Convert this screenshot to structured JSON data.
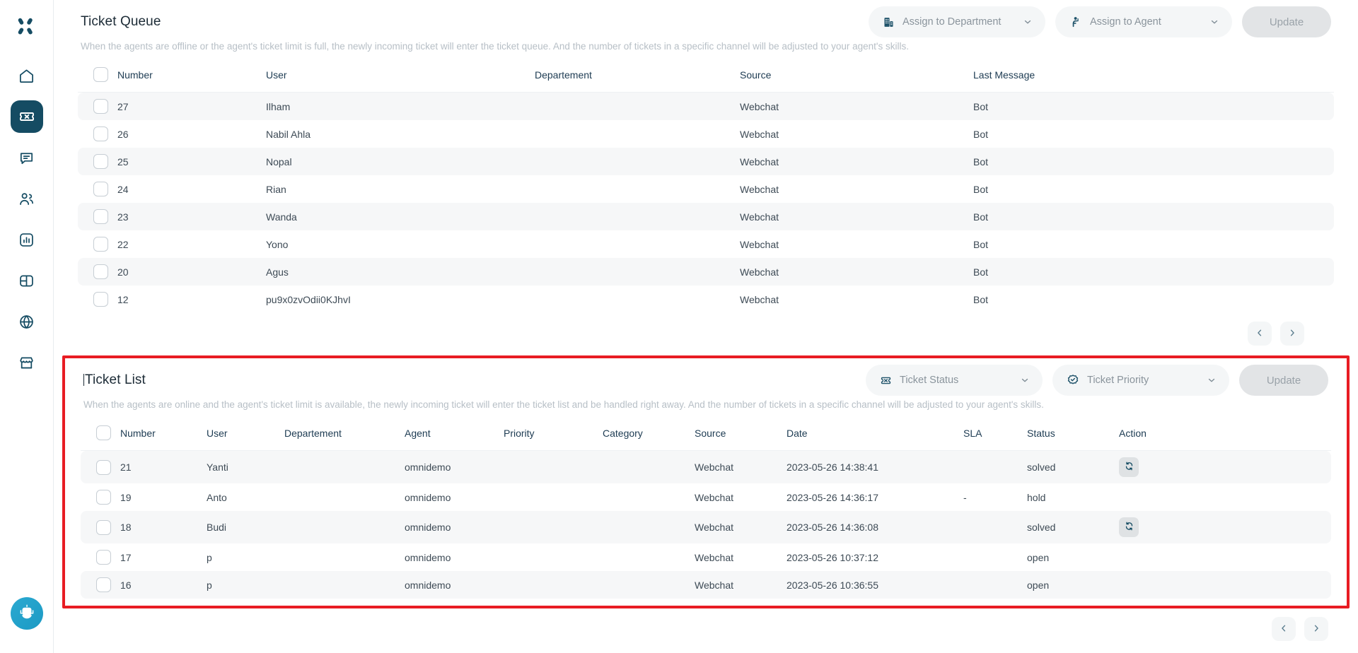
{
  "sidebar": {
    "logo_name": "app-logo",
    "items": [
      {
        "name": "home",
        "icon": "home-icon",
        "active": false
      },
      {
        "name": "ticket",
        "icon": "ticket-icon",
        "active": true
      },
      {
        "name": "chat",
        "icon": "chat-icon",
        "active": false
      },
      {
        "name": "contacts",
        "icon": "users-icon",
        "active": false
      },
      {
        "name": "analytics",
        "icon": "bar-chart-icon",
        "active": false
      },
      {
        "name": "products",
        "icon": "box-icon",
        "active": false
      },
      {
        "name": "channels",
        "icon": "globe-icon",
        "active": false
      },
      {
        "name": "store",
        "icon": "storefront-icon",
        "active": false
      }
    ],
    "bot_button": "chatbot-icon"
  },
  "queue": {
    "title": "Ticket Queue",
    "description": "When the agents are offline or the agent's ticket limit is full, the newly incoming ticket will enter the ticket queue. And the number of tickets in a specific channel will be adjusted to your agent's skills.",
    "assign_department": {
      "label": "Assign to Department",
      "icon": "building-icon"
    },
    "assign_agent": {
      "label": "Assign to Agent",
      "icon": "agent-icon"
    },
    "update_label": "Update",
    "columns": [
      "Number",
      "User",
      "Departement",
      "Source",
      "Last Message"
    ],
    "rows": [
      {
        "number": "27",
        "user": "Ilham",
        "departement": "",
        "source": "Webchat",
        "last_message": "Bot"
      },
      {
        "number": "26",
        "user": "Nabil Ahla",
        "departement": "",
        "source": "Webchat",
        "last_message": "Bot"
      },
      {
        "number": "25",
        "user": "Nopal",
        "departement": "",
        "source": "Webchat",
        "last_message": "Bot"
      },
      {
        "number": "24",
        "user": "Rian",
        "departement": "",
        "source": "Webchat",
        "last_message": "Bot"
      },
      {
        "number": "23",
        "user": "Wanda",
        "departement": "",
        "source": "Webchat",
        "last_message": "Bot"
      },
      {
        "number": "22",
        "user": "Yono",
        "departement": "",
        "source": "Webchat",
        "last_message": "Bot"
      },
      {
        "number": "20",
        "user": "Agus",
        "departement": "",
        "source": "Webchat",
        "last_message": "Bot"
      },
      {
        "number": "12",
        "user": "pu9x0zvOdii0KJhvI",
        "departement": "",
        "source": "Webchat",
        "last_message": "Bot"
      }
    ],
    "pager": {
      "prev": "chevron-left-icon",
      "next": "chevron-right-icon"
    }
  },
  "list": {
    "title": "Ticket List",
    "description": "When the agents are online and the agent's ticket limit is available, the newly incoming ticket will enter the ticket list and be handled right away. And the number of tickets in a specific channel will be adjusted to your agent's skills.",
    "status_filter": {
      "label": "Ticket Status",
      "icon": "ticket-status-icon"
    },
    "priority_filter": {
      "label": "Ticket Priority",
      "icon": "check-badge-icon"
    },
    "update_label": "Update",
    "columns": [
      "Number",
      "User",
      "Departement",
      "Agent",
      "Priority",
      "Category",
      "Source",
      "Date",
      "SLA",
      "Status",
      "Action"
    ],
    "rows": [
      {
        "number": "21",
        "user": "Yanti",
        "departement": "",
        "agent": "omnidemo",
        "priority": "",
        "category": "",
        "source": "Webchat",
        "date": "2023-05-26 14:38:41",
        "sla": "",
        "status": "solved",
        "action": "refresh-icon"
      },
      {
        "number": "19",
        "user": "Anto",
        "departement": "",
        "agent": "omnidemo",
        "priority": "",
        "category": "",
        "source": "Webchat",
        "date": "2023-05-26 14:36:17",
        "sla": "-",
        "status": "hold",
        "action": ""
      },
      {
        "number": "18",
        "user": "Budi",
        "departement": "",
        "agent": "omnidemo",
        "priority": "",
        "category": "",
        "source": "Webchat",
        "date": "2023-05-26 14:36:08",
        "sla": "",
        "status": "solved",
        "action": "refresh-icon"
      },
      {
        "number": "17",
        "user": "p",
        "departement": "",
        "agent": "omnidemo",
        "priority": "",
        "category": "",
        "source": "Webchat",
        "date": "2023-05-26 10:37:12",
        "sla": "",
        "status": "open",
        "action": ""
      },
      {
        "number": "16",
        "user": "p",
        "departement": "",
        "agent": "omnidemo",
        "priority": "",
        "category": "",
        "source": "Webchat",
        "date": "2023-05-26 10:36:55",
        "sla": "",
        "status": "open",
        "action": ""
      }
    ],
    "pager": {
      "prev": "chevron-left-icon",
      "next": "chevron-right-icon"
    }
  },
  "colors": {
    "brand_dark": "#154c63",
    "highlight": "#e81c23",
    "muted": "#b7bfc6",
    "zebra": "#f6f7f8"
  }
}
